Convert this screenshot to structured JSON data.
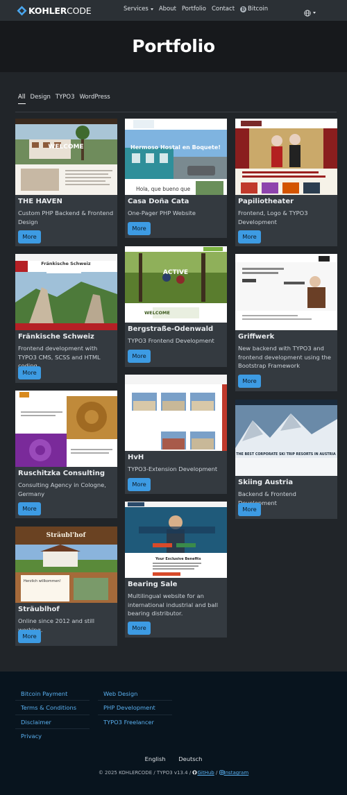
{
  "nav": {
    "brand_bold": "KOHLER",
    "brand_rest": "CODE",
    "items": [
      "Services",
      "About",
      "Portfolio",
      "Contact",
      "Bitcoin"
    ]
  },
  "hero": {
    "title": "Portfolio"
  },
  "filters": [
    "All",
    "Design",
    "TYPO3",
    "WordPress"
  ],
  "cards": [
    {
      "title": "THE HAVEN",
      "desc": "Custom PHP Backend & Frontend Design",
      "button": "More",
      "thumb_caption": "WELCOME"
    },
    {
      "title": "Casa Doña Cata",
      "desc": "One-Pager PHP Website",
      "button": "More",
      "thumb_caption": "Hermoso Hostal en Boquete!",
      "thumb_sub": "Hola, que bueno que"
    },
    {
      "title": "Papiliotheater",
      "desc": "Frontend, Logo & TYPO3 Development",
      "button": "More"
    },
    {
      "title": "Fränkische Schweiz",
      "desc": "Frontend development with TYPO3 CMS, SCSS and HTML coding.",
      "button": "More",
      "thumb_caption": "Fränkische Schweiz"
    },
    {
      "title": "Bergstraße-Odenwald",
      "desc": "TYPO3 Frontend Development",
      "button": "More",
      "thumb_caption": "ACTIVE",
      "thumb_sub": "WELCOME"
    },
    {
      "title": "Griffwerk",
      "desc": "New backend with TYPO3 and frontend development using the Bootstrap Framework",
      "button": "More"
    },
    {
      "title": "Ruschitzka Consulting",
      "desc": "Consulting Agency in Cologne, Germany",
      "button": "More"
    },
    {
      "title": "HvH",
      "desc": "TYPO3-Extension Development",
      "button": "More"
    },
    {
      "title": "Skiing Austria",
      "desc": "Backend & Frontend Development",
      "button": "More",
      "thumb_caption": "THE BEST CORPORATE SKI TRIP RESORTS IN AUSTRIA"
    },
    {
      "title": "Sträublhof",
      "desc": "Online since 2012 and still working.",
      "button": "More",
      "thumb_caption": "Sträubl'hof",
      "thumb_sub": "Herzlich willkommen!"
    },
    {
      "title": "Bearing Sale",
      "desc": "Multilingual website for an international industrial and ball bearing distributor.",
      "button": "More",
      "thumb_caption": "Your Exclusive Benefits"
    }
  ],
  "footer": {
    "col1": [
      "Bitcoin Payment",
      "Terms & Conditions",
      "Disclaimer",
      "Privacy"
    ],
    "col2": [
      "Web Design",
      "PHP Development",
      "TYPO3 Freelancer"
    ],
    "languages": [
      "English",
      "Deutsch"
    ],
    "copyright": "© 2025 KOHLERCODE / TYPO3 v13.4 /",
    "github": "GitHub",
    "sep": "/",
    "instagram": "Instagram"
  },
  "colors": {
    "accent": "#3d9be3",
    "card_bg": "#343a40",
    "page_bg": "#212529",
    "footer_bg": "#08141e"
  },
  "icons": {
    "brand": "diamond-logo-icon",
    "bitcoin": "bitcoin-icon",
    "language": "globe-icon",
    "github": "github-icon",
    "instagram": "instagram-icon"
  }
}
